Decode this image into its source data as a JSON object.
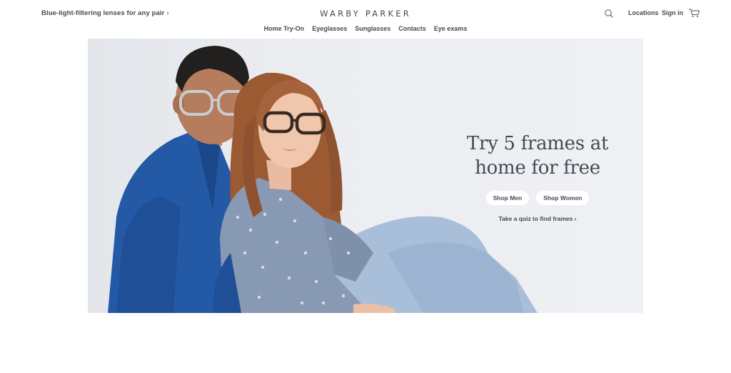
{
  "header": {
    "promo_text": "Blue-light-filtering lenses for any pair",
    "promo_chevron": "›",
    "brand": "WARBY PARKER",
    "search_icon": "search-icon",
    "locations_label": "Locations",
    "signin_label": "Sign in",
    "cart_icon": "cart-icon"
  },
  "nav": {
    "items": [
      {
        "label": "Home Try-On"
      },
      {
        "label": "Eyeglasses"
      },
      {
        "label": "Sunglasses"
      },
      {
        "label": "Contacts"
      },
      {
        "label": "Eye exams"
      }
    ]
  },
  "hero": {
    "title_line1": "Try 5 frames at",
    "title_line2": "home for free",
    "shop_men_label": "Shop Men",
    "shop_women_label": "Shop Women",
    "quiz_label": "Take a quiz to find frames",
    "quiz_chevron": "›"
  },
  "colors": {
    "text": "#414b56",
    "hero_background": "#eceef1",
    "pill_background": "#ffffff"
  }
}
